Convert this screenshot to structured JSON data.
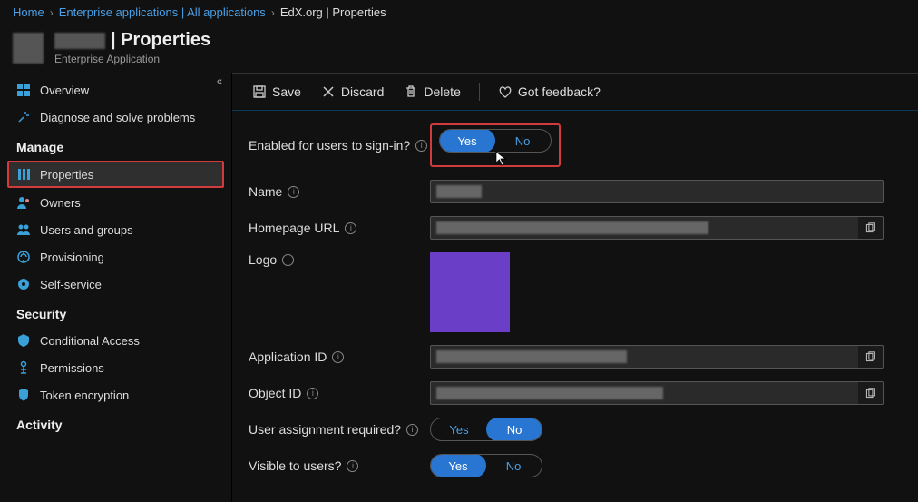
{
  "breadcrumb": {
    "home": "Home",
    "apps": "Enterprise applications | All applications",
    "current": "EdX.org | Properties"
  },
  "header": {
    "title_suffix": "| Properties",
    "subtitle": "Enterprise Application"
  },
  "toolbar": {
    "save": "Save",
    "discard": "Discard",
    "delete": "Delete",
    "feedback": "Got feedback?"
  },
  "sidebar": {
    "overview": "Overview",
    "diagnose": "Diagnose and solve problems",
    "manage": "Manage",
    "properties": "Properties",
    "owners": "Owners",
    "users_groups": "Users and groups",
    "provisioning": "Provisioning",
    "self_service": "Self-service",
    "security": "Security",
    "conditional_access": "Conditional Access",
    "permissions": "Permissions",
    "token_encryption": "Token encryption",
    "activity": "Activity"
  },
  "form": {
    "enabled": "Enabled for users to sign-in?",
    "name": "Name",
    "homepage": "Homepage URL",
    "logo": "Logo",
    "app_id": "Application ID",
    "object_id": "Object ID",
    "assignment": "User assignment required?",
    "visible": "Visible to users?",
    "yes": "Yes",
    "no": "No"
  },
  "state": {
    "enabled": "Yes",
    "assignment": "No",
    "visible": "Yes"
  }
}
